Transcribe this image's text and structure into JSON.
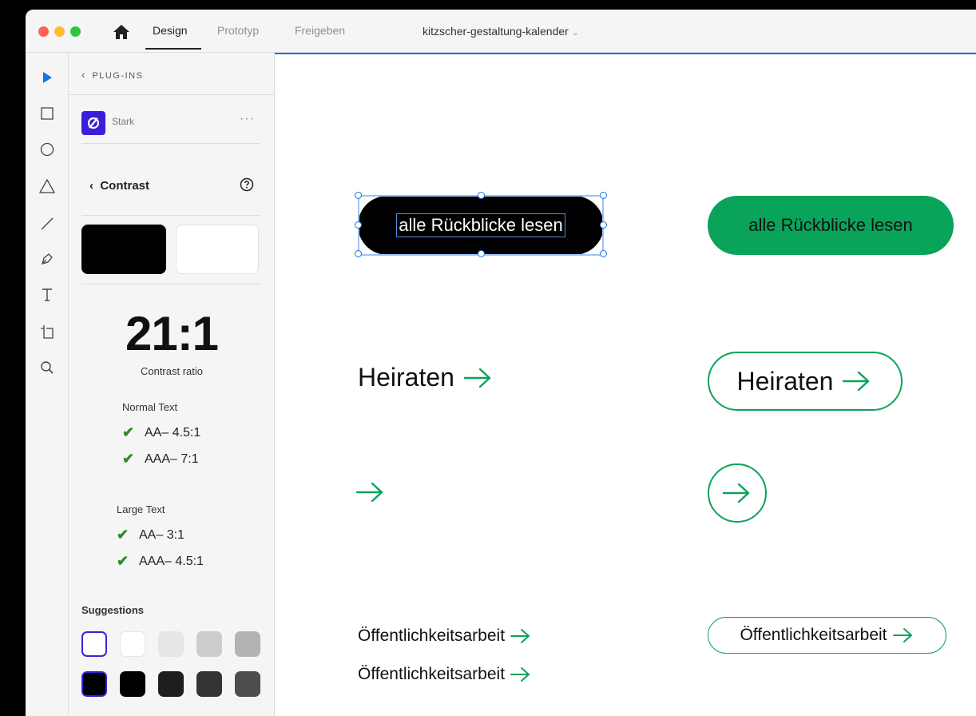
{
  "titlebar": {
    "tabs": [
      "Design",
      "Prototyp",
      "Freigeben"
    ],
    "active_tab": "Design",
    "document_title": "kitzscher-gestaltung-kalender",
    "title_chevron": "⌄"
  },
  "toolbar": {
    "tools": [
      "select-tool",
      "rectangle-tool",
      "ellipse-tool",
      "polygon-tool",
      "line-tool",
      "pen-tool",
      "text-tool",
      "artboard-tool",
      "zoom-tool"
    ]
  },
  "panel": {
    "back_label": "PLUG-INS",
    "plugin_name": "Stark",
    "more_label": "···",
    "section_title": "Contrast",
    "ratio": "21:1",
    "ratio_label": "Contrast ratio",
    "normal_text": {
      "heading": "Normal Text",
      "aa": "AA– 4.5:1",
      "aaa": "AAA– 7:1"
    },
    "large_text": {
      "heading": "Large Text",
      "aa": "AA– 3:1",
      "aaa": "AAA– 4.5:1"
    },
    "suggestions_heading": "Suggestions",
    "suggestion_row1_colors": [
      "#ffffff",
      "#ffffff",
      "#e6e6e6",
      "#cccccc",
      "#b3b3b3"
    ],
    "suggestion_row2_colors": [
      "#000000",
      "#000000",
      "#1e1e1e",
      "#333333",
      "#4d4d4d"
    ]
  },
  "canvas": {
    "button_text": "alle Rückblicke lesen",
    "heiraten": "Heiraten",
    "oeffentlich": "Öffentlichkeitsarbeit",
    "accent_color": "#0aa35a"
  }
}
